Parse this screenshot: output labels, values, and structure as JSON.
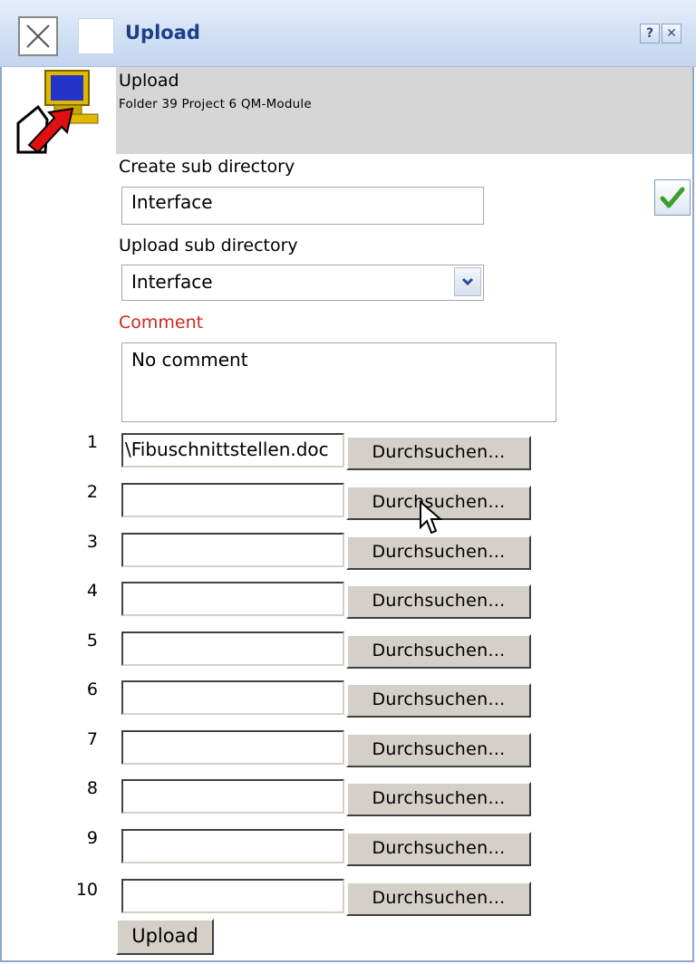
{
  "window": {
    "title": "Upload",
    "help_label": "?",
    "close_label": "✕"
  },
  "header": {
    "title": "Upload",
    "subtitle": "Folder 39 Project 6 QM-Module"
  },
  "form": {
    "create_sub_directory_label": "Create sub directory",
    "create_sub_directory_value": "Interface",
    "upload_sub_directory_label": "Upload sub directory",
    "upload_sub_directory_value": "Interface",
    "comment_label": "Comment",
    "comment_value": "No comment",
    "comment_color": "#d0281c"
  },
  "files": [
    {
      "num": "1",
      "value": "\\Fibuschnittstellen.doc",
      "browse": "Durchsuchen..."
    },
    {
      "num": "2",
      "value": "",
      "browse": "Durchsuchen..."
    },
    {
      "num": "3",
      "value": "",
      "browse": "Durchsuchen..."
    },
    {
      "num": "4",
      "value": "",
      "browse": "Durchsuchen..."
    },
    {
      "num": "5",
      "value": "",
      "browse": "Durchsuchen..."
    },
    {
      "num": "6",
      "value": "",
      "browse": "Durchsuchen..."
    },
    {
      "num": "7",
      "value": "",
      "browse": "Durchsuchen..."
    },
    {
      "num": "8",
      "value": "",
      "browse": "Durchsuchen..."
    },
    {
      "num": "9",
      "value": "",
      "browse": "Durchsuchen..."
    },
    {
      "num": "10",
      "value": "",
      "browse": "Durchsuchen..."
    }
  ],
  "actions": {
    "upload_label": "Upload"
  },
  "icons": {
    "close": "close-icon",
    "app": "computer-upload-icon",
    "confirm": "checkmark-icon",
    "dropdown": "chevron-down-icon",
    "cursor": "mouse-pointer-icon"
  }
}
